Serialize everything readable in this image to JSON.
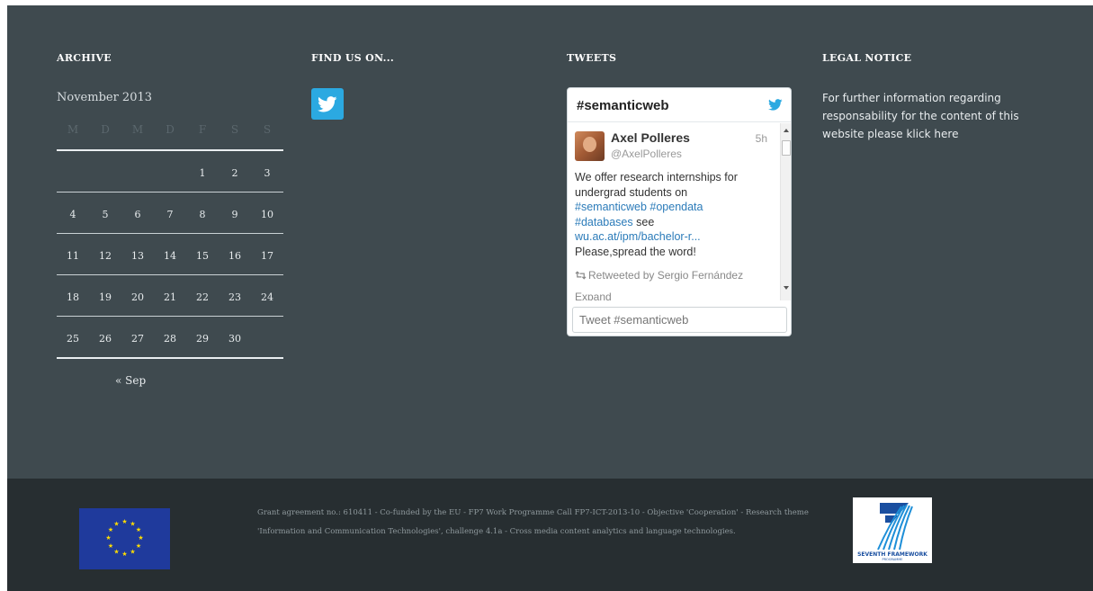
{
  "archive": {
    "title": "ARCHIVE",
    "caption": "November 2013",
    "weekdays": [
      "M",
      "D",
      "M",
      "D",
      "F",
      "S",
      "S"
    ],
    "weeks": [
      [
        "",
        "",
        "",
        "",
        "1",
        "2",
        "3"
      ],
      [
        "4",
        "5",
        "6",
        "7",
        "8",
        "9",
        "10"
      ],
      [
        "11",
        "12",
        "13",
        "14",
        "15",
        "16",
        "17"
      ],
      [
        "18",
        "19",
        "20",
        "21",
        "22",
        "23",
        "24"
      ],
      [
        "25",
        "26",
        "27",
        "28",
        "29",
        "30",
        ""
      ]
    ],
    "prev_link": "« Sep"
  },
  "find_us": {
    "title": "FIND US ON...",
    "icon": "twitter-icon",
    "color": "#2ba9e1"
  },
  "tweets": {
    "title": "TWEETS",
    "widget_title": "#semanticweb",
    "tweet": {
      "name": "Axel Polleres",
      "handle": "@AxelPolleres",
      "time": "5h",
      "text_1": "We offer research internships for undergrad students on",
      "tag_1": "#semanticweb",
      "tag_2": "#opendata",
      "tag_3": "#databases",
      "see": "see",
      "link": "wu.ac.at/ipm/bachelor-r...",
      "text_2": "Please,spread the word!",
      "retweet": "Retweeted by Sergio Fernández",
      "expand": "Expand"
    },
    "input_placeholder": "Tweet #semanticweb",
    "link_color": "#2b7bb9"
  },
  "legal": {
    "title": "LEGAL NOTICE",
    "text": "For further information regarding responsability for the content of this website please klick here"
  },
  "footer": {
    "text": "Grant agreement no.: 610411 - Co-funded by the EU - FP7 Work Programme Call FP7-ICT-2013-10 - Objective 'Cooperation' - Research theme 'Information and Communication Technologies', challenge 4.1a - Cross media content analytics and language technologies.",
    "fp7_logo_text": "SEVENTH FRAMEWORK",
    "fp7_logo_sub": "PROGRAMME"
  },
  "colors": {
    "upper_bg": "#3f4a4f",
    "footer_bg": "#272e31",
    "eu_blue": "#1f3a9c",
    "eu_star": "#ffdd00"
  }
}
